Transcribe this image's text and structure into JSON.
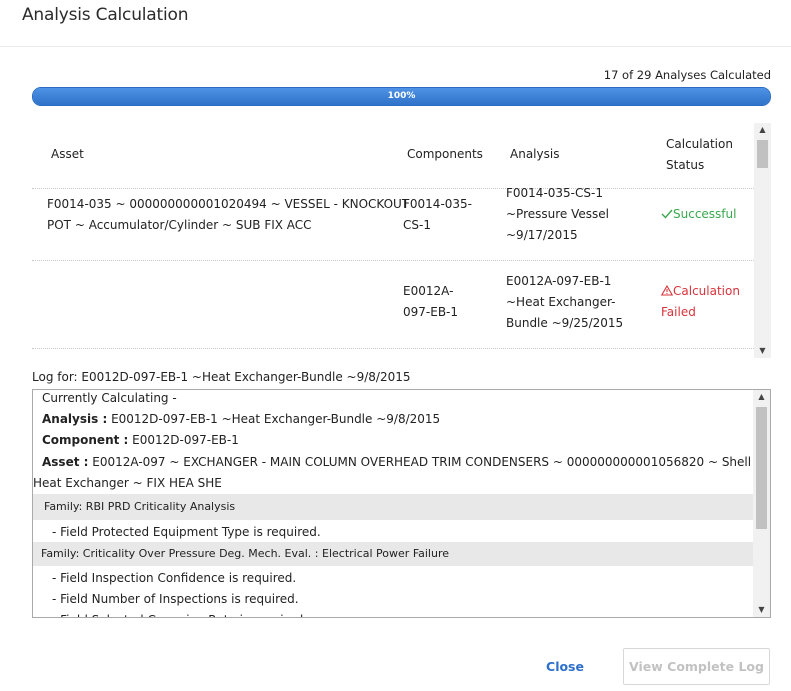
{
  "dialog": {
    "title": "Analysis Calculation"
  },
  "progress": {
    "count_text": "17 of 29 Analyses Calculated",
    "percent_label": "100%",
    "fraction": 1.0
  },
  "grid": {
    "headers": {
      "asset": "Asset",
      "components": "Components",
      "analysis": "Analysis",
      "status_line1": "Calculation",
      "status_line2": "Status"
    },
    "rows": [
      {
        "asset_l1": "F0014-035 ~ 000000000001020494 ~ VESSEL - KNOCKOUT",
        "asset_l2": "POT ~ Accumulator/Cylinder ~ SUB FIX ACC",
        "comp_l1": "F0014-035-",
        "comp_l2": "CS-1",
        "an_l1": "F0014-035-CS-1",
        "an_l2": "~Pressure Vessel",
        "an_l3": "~9/17/2015",
        "status_icon": "check-icon",
        "status_l1": "Successful"
      },
      {
        "comp_l1": "E0012A-",
        "comp_l2": "097-EB-1",
        "an_l1": "E0012A-097-EB-1",
        "an_l2": "~Heat Exchanger-",
        "an_l3": "Bundle ~9/25/2015",
        "status_icon": "warning-icon",
        "status_l1": "Calculation",
        "status_l2": "Failed"
      }
    ]
  },
  "log": {
    "header": "Log for: E0012D-097-EB-1 ~Heat Exchanger-Bundle ~9/8/2015",
    "currently": "Currently Calculating -",
    "analysis_label": "Analysis :",
    "analysis_value": " E0012D-097-EB-1 ~Heat Exchanger-Bundle ~9/8/2015",
    "component_label": "Component :",
    "component_value": " E0012D-097-EB-1",
    "asset_label": "Asset :",
    "asset_value_l1": " E0012A-097 ~ EXCHANGER - MAIN COLUMN OVERHEAD TRIM CONDENSERS ~ 000000000001056820 ~ Shell and Tube",
    "asset_value_l2": "Heat Exchanger ~ FIX HEA SHE",
    "family1": "Family: RBI PRD Criticality Analysis",
    "family1_msg": "- Field Protected Equipment Type is required.",
    "family2": "Family: Criticality Over Pressure Deg. Mech. Eval. : Electrical Power Failure",
    "family2_msg1": "- Field Inspection Confidence is required.",
    "family2_msg2": "- Field Number of Inspections is required.",
    "family2_msg3": "- Field Selected Corrosion Rate is required."
  },
  "footer": {
    "close": "Close",
    "view_log": "View Complete Log"
  },
  "colors": {
    "accent": "#2d6fcb",
    "success": "#37a84d",
    "failure": "#d9333a",
    "progress": "#3d82d9"
  }
}
